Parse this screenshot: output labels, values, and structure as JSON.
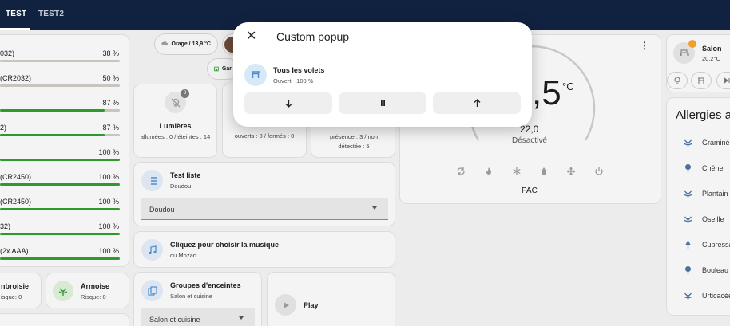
{
  "tabs": [
    {
      "label": "TEST"
    },
    {
      "label": "TEST2"
    }
  ],
  "batteries": [
    {
      "label": "032)",
      "value": "38 %",
      "level": 0.38,
      "color": "#c9c4bd"
    },
    {
      "label": "(CR2032)",
      "value": "50 %",
      "level": 0.5,
      "color": "#c9c4bd"
    },
    {
      "label": "",
      "value": "87 %",
      "level": 0.87,
      "color": "#2e9a2e"
    },
    {
      "label": "2)",
      "value": "87 %",
      "level": 0.87,
      "color": "#2e9a2e"
    },
    {
      "label": "",
      "value": "100 %",
      "level": 1.0,
      "color": "#2e9a2e"
    },
    {
      "label": "(CR2450)",
      "value": "100 %",
      "level": 1.0,
      "color": "#2e9a2e"
    },
    {
      "label": "(CR2450)",
      "value": "100 %",
      "level": 1.0,
      "color": "#2e9a2e"
    },
    {
      "label": "32)",
      "value": "100 %",
      "level": 1.0,
      "color": "#2e9a2e"
    },
    {
      "label": "(2x AAA)",
      "value": "100 %",
      "level": 1.0,
      "color": "#2e9a2e"
    }
  ],
  "pollen": {
    "ambroisie": {
      "name": "nbroisie",
      "risk": "isque: 0"
    },
    "armoise": {
      "name": "Armoise",
      "risk": "Risque: 0"
    }
  },
  "chips": {
    "weather": "Orage / 13,9 °C",
    "garage": "Gar"
  },
  "lights": {
    "title": "Lumières",
    "status": "allumées : 0 / éteintes : 14",
    "badge": "3"
  },
  "shutters_status": "ouverts : 8 / fermés : 0",
  "presence_status": "présence : 3 / non détectée : 5",
  "test_list": {
    "title": "Test liste",
    "subtitle": "Doudou",
    "selected": "Doudou"
  },
  "music": {
    "title": "Cliquez pour choisir la musique",
    "subtitle": "du Mozart"
  },
  "speakers": {
    "title": "Groupes d'enceintes",
    "subtitle": "Salon et cuisine",
    "selected": "Salon et cuisine"
  },
  "play_label": "Play",
  "thermostat": {
    "current": ",5",
    "unit": "°C",
    "target": "22,0",
    "state": "Désactivé",
    "name": "PAC"
  },
  "room": {
    "name": "Salon",
    "temp": "20.2°C"
  },
  "allergies": {
    "title": "Allergies a",
    "items": [
      "Graminées",
      "Chêne",
      "Plantain",
      "Oseille",
      "Cupressacées",
      "Bouleau",
      "Urticacées"
    ]
  },
  "popup": {
    "title": "Custom popup",
    "entity_name": "Tous les volets",
    "entity_state": "Ouvert - 100 %"
  },
  "colors": {
    "accent": "#4a8fd0",
    "header": "#112240",
    "battery_ok": "#2e9a2e"
  }
}
